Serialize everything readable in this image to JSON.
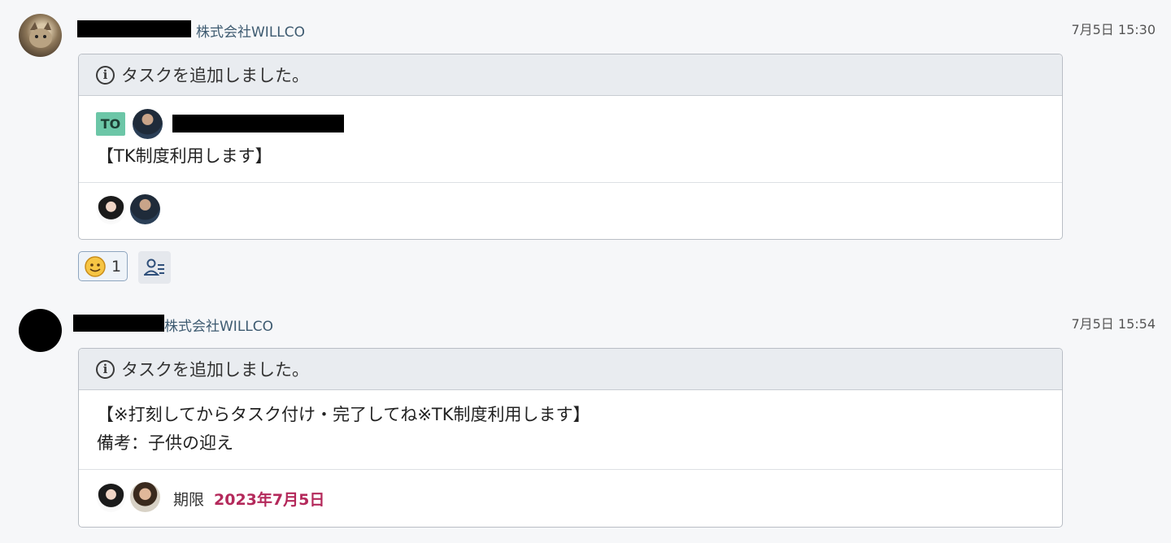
{
  "messages": [
    {
      "sender_company": "株式会社WILLCO",
      "timestamp": "7月5日 15:30",
      "card_title": "タスクを追加しました。",
      "to_label": "TO",
      "body": "【TK制度利用します】",
      "reaction_count": "1"
    },
    {
      "sender_company": "株式会社WILLCO",
      "timestamp": "7月5日 15:54",
      "card_title": "タスクを追加しました。",
      "body_line1": "【※打刻してからタスク付け・完了してね※TK制度利用します】",
      "body_line2": "備考：子供の迎え",
      "deadline_label": "期限",
      "deadline_date": "2023年7月5日"
    }
  ],
  "icons": {
    "info": "info-icon",
    "reaction": "smile-emoji-icon",
    "task": "task-assign-icon"
  },
  "colors": {
    "to_badge": "#6cc6a7",
    "deadline": "#b4295b",
    "company": "#3d5a70"
  }
}
